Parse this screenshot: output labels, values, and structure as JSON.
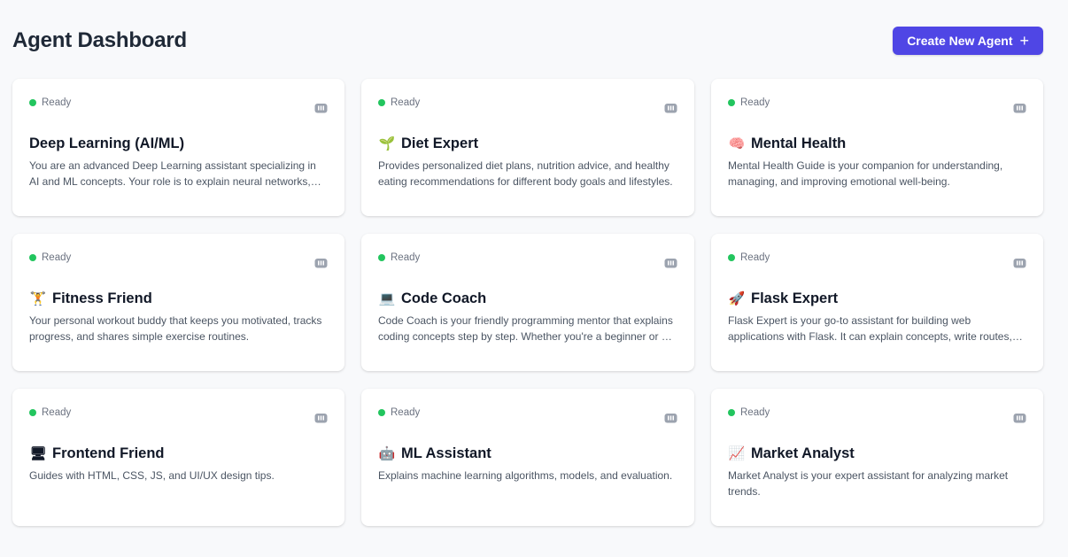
{
  "header": {
    "title": "Agent Dashboard",
    "create_label": "Create New Agent",
    "create_icon": "+"
  },
  "colors": {
    "accent": "#4f46e5",
    "status_ready": "#22c55e"
  },
  "agents": [
    {
      "status": "Ready",
      "emoji": "",
      "name": "Deep Learning (AI/ML)",
      "description": "You are an advanced Deep Learning assistant specializing in AI and ML concepts. Your role is to explain neural networks, deep learning architectures, and machine learning algorithms."
    },
    {
      "status": "Ready",
      "emoji": "🌱",
      "name": "Diet Expert",
      "description": "Provides personalized diet plans, nutrition advice, and healthy eating recommendations for different body goals and lifestyles."
    },
    {
      "status": "Ready",
      "emoji": "🧠",
      "name": "Mental Health",
      "description": "Mental Health Guide is your companion for understanding, managing, and improving emotional well-being."
    },
    {
      "status": "Ready",
      "emoji": "🏋",
      "name": "Fitness Friend",
      "description": "Your personal workout buddy that keeps you motivated, tracks progress, and shares simple exercise routines."
    },
    {
      "status": "Ready",
      "emoji": "💻",
      "name": "Code Coach",
      "description": "Code Coach is your friendly programming mentor that explains coding concepts step by step. Whether you're a beginner or an experienced developer."
    },
    {
      "status": "Ready",
      "emoji": "🚀",
      "name": "Flask Expert",
      "description": "Flask Expert is your go-to assistant for building web applications with Flask. It can explain concepts, write routes, and debug code."
    },
    {
      "status": "Ready",
      "emoji": "🖥",
      "name": "Frontend Friend",
      "description": "Guides with HTML, CSS, JS, and UI/UX design tips."
    },
    {
      "status": "Ready",
      "emoji": "🤖",
      "name": "ML Assistant",
      "description": "Explains machine learning algorithms, models, and evaluation."
    },
    {
      "status": "Ready",
      "emoji": "📈",
      "name": "Market Analyst",
      "description": "Market Analyst is your expert assistant for analyzing market trends."
    }
  ]
}
